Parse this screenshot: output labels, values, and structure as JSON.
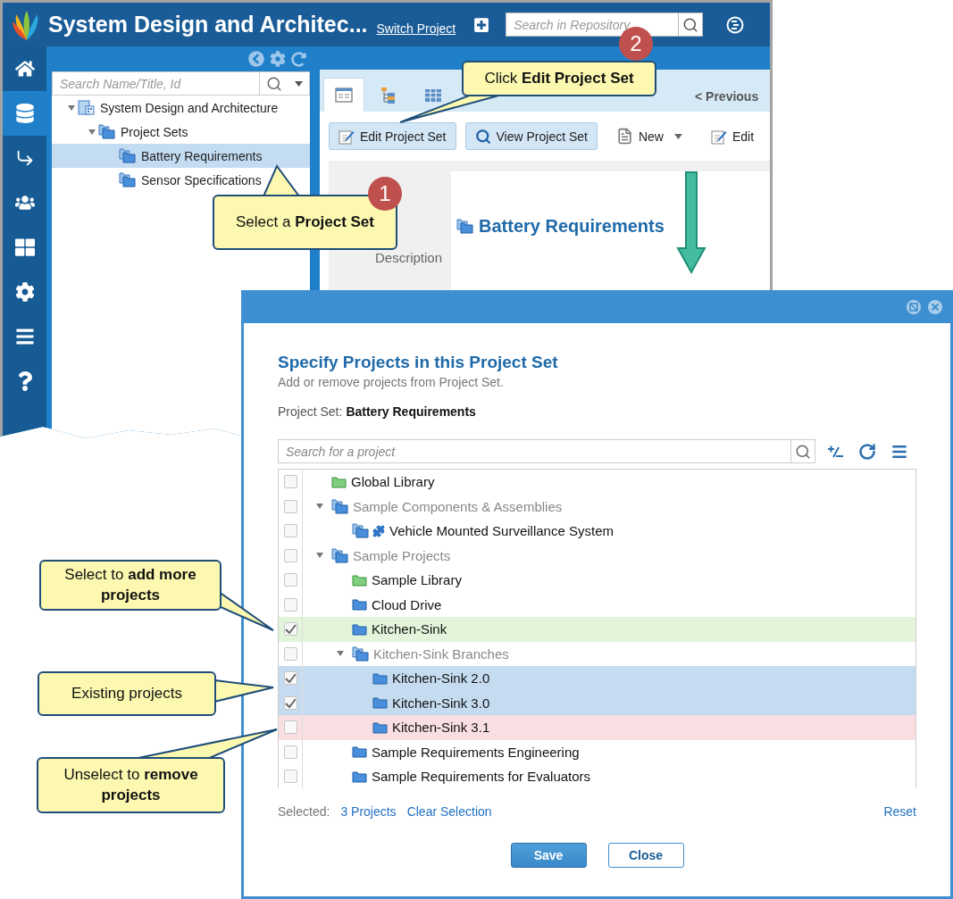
{
  "app": {
    "title": "System Design and Architec...",
    "switch_link": "Switch Project",
    "search_placeholder": "Search in Repository"
  },
  "nav": [
    {
      "kind": "home",
      "selected": false
    },
    {
      "kind": "database",
      "selected": true
    },
    {
      "kind": "share",
      "selected": false
    },
    {
      "kind": "users",
      "selected": false
    },
    {
      "kind": "grid",
      "selected": false
    },
    {
      "kind": "settings",
      "selected": false
    },
    {
      "kind": "menu",
      "selected": false
    },
    {
      "kind": "help",
      "selected": false
    }
  ],
  "left_panel": {
    "search_placeholder": "Search Name/Title, Id",
    "tree": [
      {
        "label": "System Design and Architecture",
        "kind": "project",
        "expanded": true,
        "selected": false,
        "children": [
          {
            "label": "Project Sets",
            "kind": "sets",
            "expanded": true,
            "selected": false,
            "children": [
              {
                "label": "Battery Requirements",
                "kind": "set",
                "selected": true
              },
              {
                "label": "Sensor Specifications",
                "kind": "set",
                "selected": false
              }
            ]
          }
        ]
      }
    ]
  },
  "detail": {
    "tabs": [
      {
        "kind": "details",
        "selected": true
      },
      {
        "kind": "tree",
        "selected": false
      },
      {
        "kind": "grid",
        "selected": false
      }
    ],
    "previous_link": "< Previous",
    "toolbar": [
      {
        "label": "Edit Project Set",
        "kind": "edit-set"
      },
      {
        "label": "View Project Set",
        "kind": "view-set"
      },
      {
        "label": "New",
        "kind": "new"
      },
      {
        "label": "Edit",
        "kind": "edit"
      }
    ],
    "title": "Battery Requirements",
    "field_label": "Description"
  },
  "dialog": {
    "title": "Specify Projects in this Project Set",
    "subtitle": "Add or remove projects from Project Set.",
    "set_label": "Project Set:",
    "set_name": "Battery Requirements",
    "search_placeholder": "Search for a project",
    "tree": [
      {
        "label": "Global Library",
        "kind": "library",
        "checked": false
      },
      {
        "label": "Sample Components & Assemblies",
        "kind": "group",
        "checked": false,
        "expanded": true,
        "children": [
          {
            "label": "Vehicle Mounted Surveillance System",
            "kind": "product",
            "checked": false
          }
        ]
      },
      {
        "label": "Sample Projects",
        "kind": "group",
        "checked": false,
        "expanded": true,
        "children": [
          {
            "label": "Sample Library",
            "kind": "library",
            "checked": false
          },
          {
            "label": "Cloud Drive",
            "kind": "folder",
            "checked": false
          },
          {
            "label": "Kitchen-Sink",
            "kind": "folder",
            "checked": true,
            "color": "#e2f5da"
          },
          {
            "label": "Kitchen-Sink Branches",
            "kind": "group",
            "checked": false,
            "expanded": true,
            "children": [
              {
                "label": "Kitchen-Sink 2.0",
                "kind": "folder",
                "checked": true,
                "color": "#c5dcf0"
              },
              {
                "label": "Kitchen-Sink 3.0",
                "kind": "folder",
                "checked": true,
                "color": "#c5dcf0"
              },
              {
                "label": "Kitchen-Sink 3.1",
                "kind": "folder",
                "checked": false,
                "color": "#f9dfe1"
              }
            ]
          },
          {
            "label": "Sample Requirements Engineering",
            "kind": "folder",
            "checked": false
          },
          {
            "label": "Sample Requirements for Evaluators",
            "kind": "folder",
            "checked": false
          }
        ]
      }
    ],
    "selected_label": "Selected:",
    "selected_count": "3 Projects",
    "clear_link": "Clear Selection",
    "reset_link": "Reset",
    "buttons": [
      {
        "label": "Save",
        "kind": "primary"
      },
      {
        "label": "Close",
        "kind": "secondary"
      }
    ]
  },
  "callouts": [
    {
      "text": "Select a **Project Set**",
      "badge": "1"
    },
    {
      "text": "Click **Edit Project Set**",
      "badge": "2"
    },
    {
      "text": "Select to **add more projects**"
    },
    {
      "text": "Existing projects"
    },
    {
      "text": "Unselect to **remove projects**"
    }
  ]
}
